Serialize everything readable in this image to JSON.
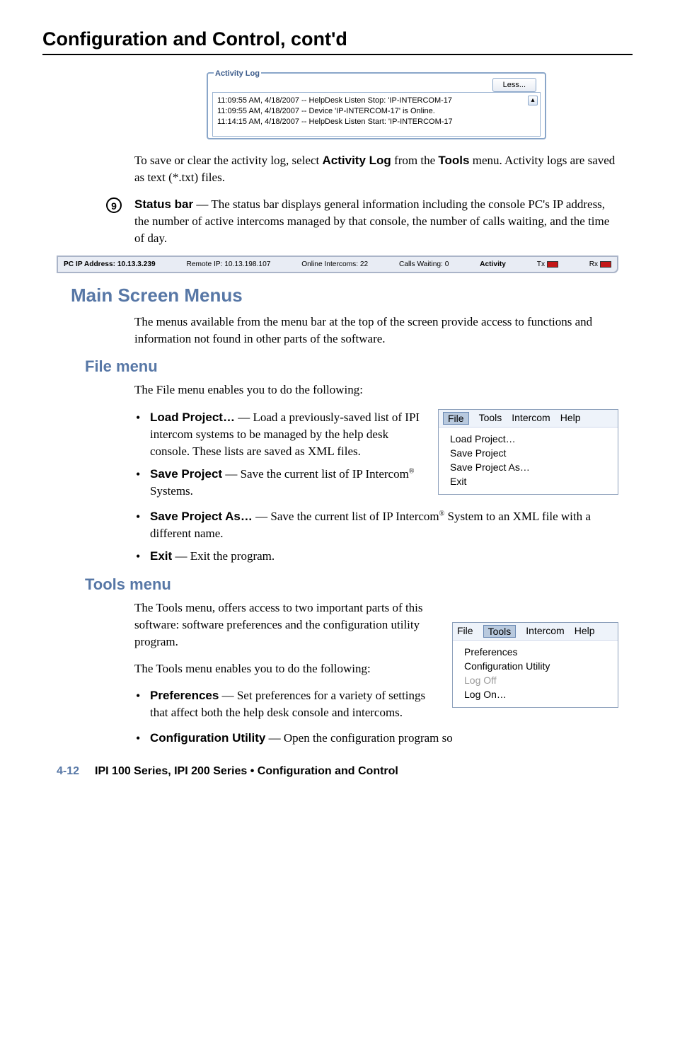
{
  "page_title": "Configuration and Control, cont'd",
  "activity_log": {
    "title": "Activity Log",
    "less_button": "Less...",
    "lines": [
      "11:09:55 AM, 4/18/2007 -- HelpDesk Listen Stop: 'IP-INTERCOM-17",
      "11:09:55 AM, 4/18/2007 -- Device 'IP-INTERCOM-17' is Online.",
      "11:14:15 AM, 4/18/2007 -- HelpDesk Listen Start: 'IP-INTERCOM-17"
    ]
  },
  "para1_pre": "To save or clear the activity log, select ",
  "para1_bold1": "Activity Log",
  "para1_mid": " from the ",
  "para1_bold2": "Tools",
  "para1_post": " menu.  Activity logs are saved as text (*.txt) files.",
  "circled_num": "9",
  "status_bold": "Status bar",
  "status_text": " — The status bar displays general information including the console PC's IP address, the number of active intercoms managed by that console, the number of calls waiting, and the time of day.",
  "statusbar": {
    "pc_ip_label": "PC IP Address:  10.13.3.239",
    "remote_ip": "Remote IP: 10.13.198.107",
    "online": "Online Intercoms: 22",
    "calls": "Calls Waiting: 0",
    "activity": "Activity",
    "tx": "Tx",
    "rx": "Rx"
  },
  "h2_main": "Main Screen Menus",
  "main_para": "The menus available from the menu bar at the top of the screen provide access to functions and information not found in other parts of the software.",
  "h3_file": "File menu",
  "file_intro": "The File menu enables you to do the following:",
  "file_menu": {
    "menubar": [
      "File",
      "Tools",
      "Intercom",
      "Help"
    ],
    "items": [
      "Load Project…",
      "Save Project",
      "Save Project As…",
      "Exit"
    ]
  },
  "file_bullets": {
    "load": {
      "bold": "Load Project…",
      "text": " — Load a previously-saved list of IPI intercom systems to be managed by the help desk console.  These lists are saved as XML files."
    },
    "save": {
      "bold": "Save Project",
      "text": " — Save the current list of IP Intercom",
      "reg": "®",
      "text2": " Systems."
    },
    "saveas": {
      "bold": "Save Project As…",
      "text": " — Save the current list of IP Intercom",
      "reg": "®",
      "text2": " System to an XML file with a different name."
    },
    "exit": {
      "bold": "Exit",
      "text": " — Exit the program."
    }
  },
  "h3_tools": "Tools menu",
  "tools_para_pre": "The Tools menu, offers access to two important parts of this software: software preferences and the configuration utility program.",
  "tools_para2": "The Tools menu enables you to do the following:",
  "tools_menu": {
    "menubar": [
      "File",
      "Tools",
      "Intercom",
      "Help"
    ],
    "items": [
      {
        "label": "Preferences",
        "gray": false
      },
      {
        "label": "Configuration Utility",
        "gray": false
      },
      {
        "label": "Log Off",
        "gray": true
      },
      {
        "label": "Log On…",
        "gray": false
      }
    ]
  },
  "tools_bullets": {
    "prefs": {
      "bold": "Preferences",
      "text": " — Set preferences for a variety of settings that affect both the help desk console and intercoms."
    },
    "config": {
      "bold": "Configuration Utility",
      "text": " — Open the configuration program so"
    }
  },
  "footer": {
    "pagenum": "4-12",
    "title": "IPI 100 Series, IPI 200 Series • Configuration and Control"
  }
}
